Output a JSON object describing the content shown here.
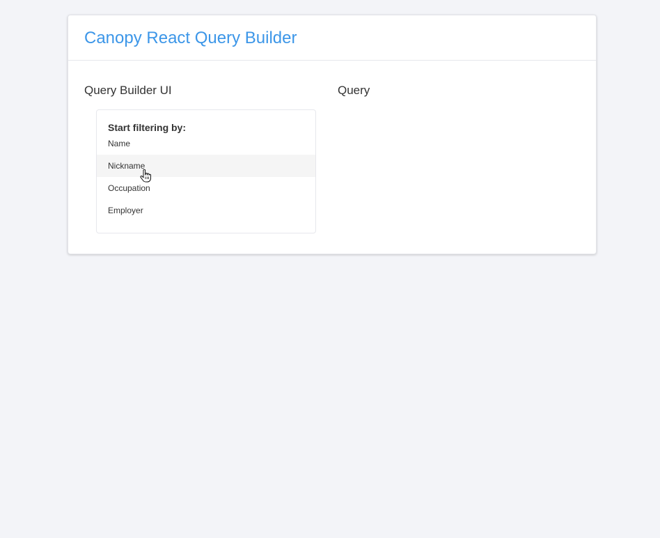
{
  "app": {
    "title": "Canopy React Query Builder"
  },
  "sections": {
    "builder_title": "Query Builder UI",
    "query_title": "Query"
  },
  "filter_menu": {
    "heading": "Start filtering by:",
    "items": [
      {
        "label": "Name",
        "hovered": false
      },
      {
        "label": "Nickname",
        "hovered": true
      },
      {
        "label": "Occupation",
        "hovered": false
      },
      {
        "label": "Employer",
        "hovered": false
      }
    ]
  },
  "colors": {
    "accent": "#3c96e8",
    "background": "#f3f4f8",
    "hover": "#f5f5f5"
  }
}
